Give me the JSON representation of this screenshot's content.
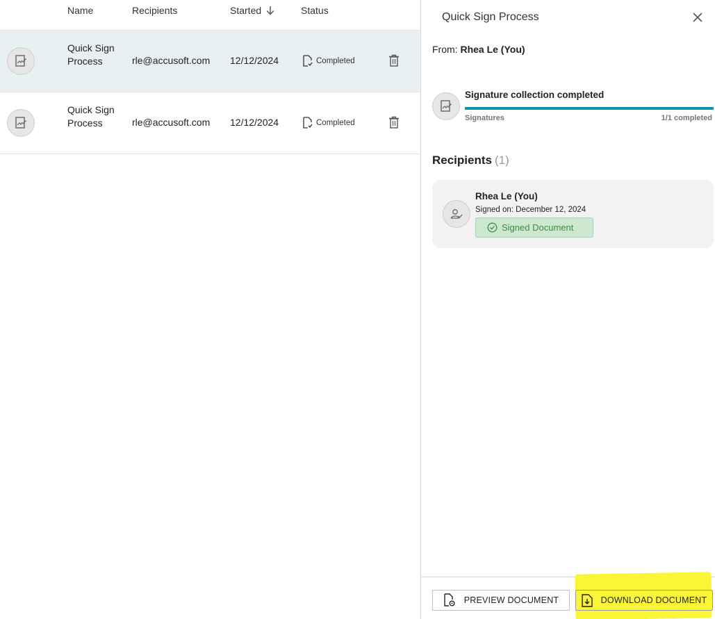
{
  "table": {
    "headers": {
      "name": "Name",
      "recipients": "Recipients",
      "started": "Started",
      "status": "Status"
    },
    "rows": [
      {
        "name": "Quick Sign Process",
        "recipient": "rle@accusoft.com",
        "started": "12/12/2024",
        "status": "Completed",
        "selected": true
      },
      {
        "name": "Quick Sign Process",
        "recipient": "rle@accusoft.com",
        "started": "12/12/2024",
        "status": "Completed",
        "selected": false
      }
    ]
  },
  "panel": {
    "title": "Quick Sign Process",
    "from_label": "From:",
    "from_name": "Rhea Le (You)",
    "signature": {
      "title": "Signature collection completed",
      "label": "Signatures",
      "count_text": "1/1 completed",
      "progress": 1.0
    },
    "recipients_heading": "Recipients",
    "recipients_count": "(1)",
    "recipient": {
      "name": "Rhea Le (You)",
      "signed_on": "Signed on: December 12, 2024",
      "badge": "Signed Document"
    },
    "buttons": {
      "preview": "PREVIEW DOCUMENT",
      "download": "DOWNLOAD DOCUMENT"
    }
  },
  "colors": {
    "accent": "#0d93a8",
    "selected_row": "#e8f0f2",
    "badge_bg": "#cde8cf",
    "badge_text": "#3d8c45",
    "highlight": "#fbf538"
  },
  "icons": {
    "sort": "arrow-down-icon",
    "document": "document-signature-icon",
    "status": "document-check-icon",
    "delete": "trash-icon",
    "close": "close-icon",
    "recipient": "user-check-icon",
    "badge": "check-circle-icon",
    "preview": "document-preview-icon",
    "download": "document-download-icon"
  }
}
